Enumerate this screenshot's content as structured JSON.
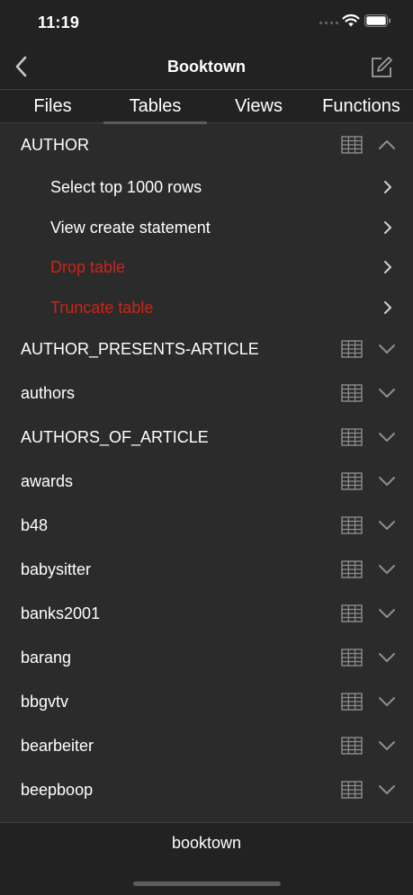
{
  "status_bar": {
    "time": "11:19"
  },
  "nav": {
    "title": "Booktown"
  },
  "tabs": [
    {
      "label": "Files"
    },
    {
      "label": "Tables",
      "active": true
    },
    {
      "label": "Views"
    },
    {
      "label": "Functions"
    }
  ],
  "expanded_table": {
    "name": "AUTHOR",
    "actions": [
      {
        "label": "Select top 1000 rows",
        "destructive": false
      },
      {
        "label": "View create statement",
        "destructive": false
      },
      {
        "label": "Drop table",
        "destructive": true
      },
      {
        "label": "Truncate table",
        "destructive": true
      }
    ]
  },
  "tables": [
    "AUTHOR_PRESENTS-ARTICLE",
    "authors",
    "AUTHORS_OF_ARTICLE",
    "awards",
    "b48",
    "babysitter",
    "banks2001",
    "barang",
    "bbgvtv",
    "bearbeiter",
    "beepboop"
  ],
  "footer": {
    "database": "booktown"
  },
  "colors": {
    "background": "#2b2b2c",
    "bar": "#222223",
    "destructive": "#cc2418",
    "icon": "#8e8e93"
  },
  "icons": {
    "back": "chevron-left-icon",
    "compose": "compose-icon",
    "table": "table-grid-icon",
    "expand": "chevron-down-icon",
    "collapse": "chevron-up-icon",
    "action": "chevron-right-icon"
  }
}
